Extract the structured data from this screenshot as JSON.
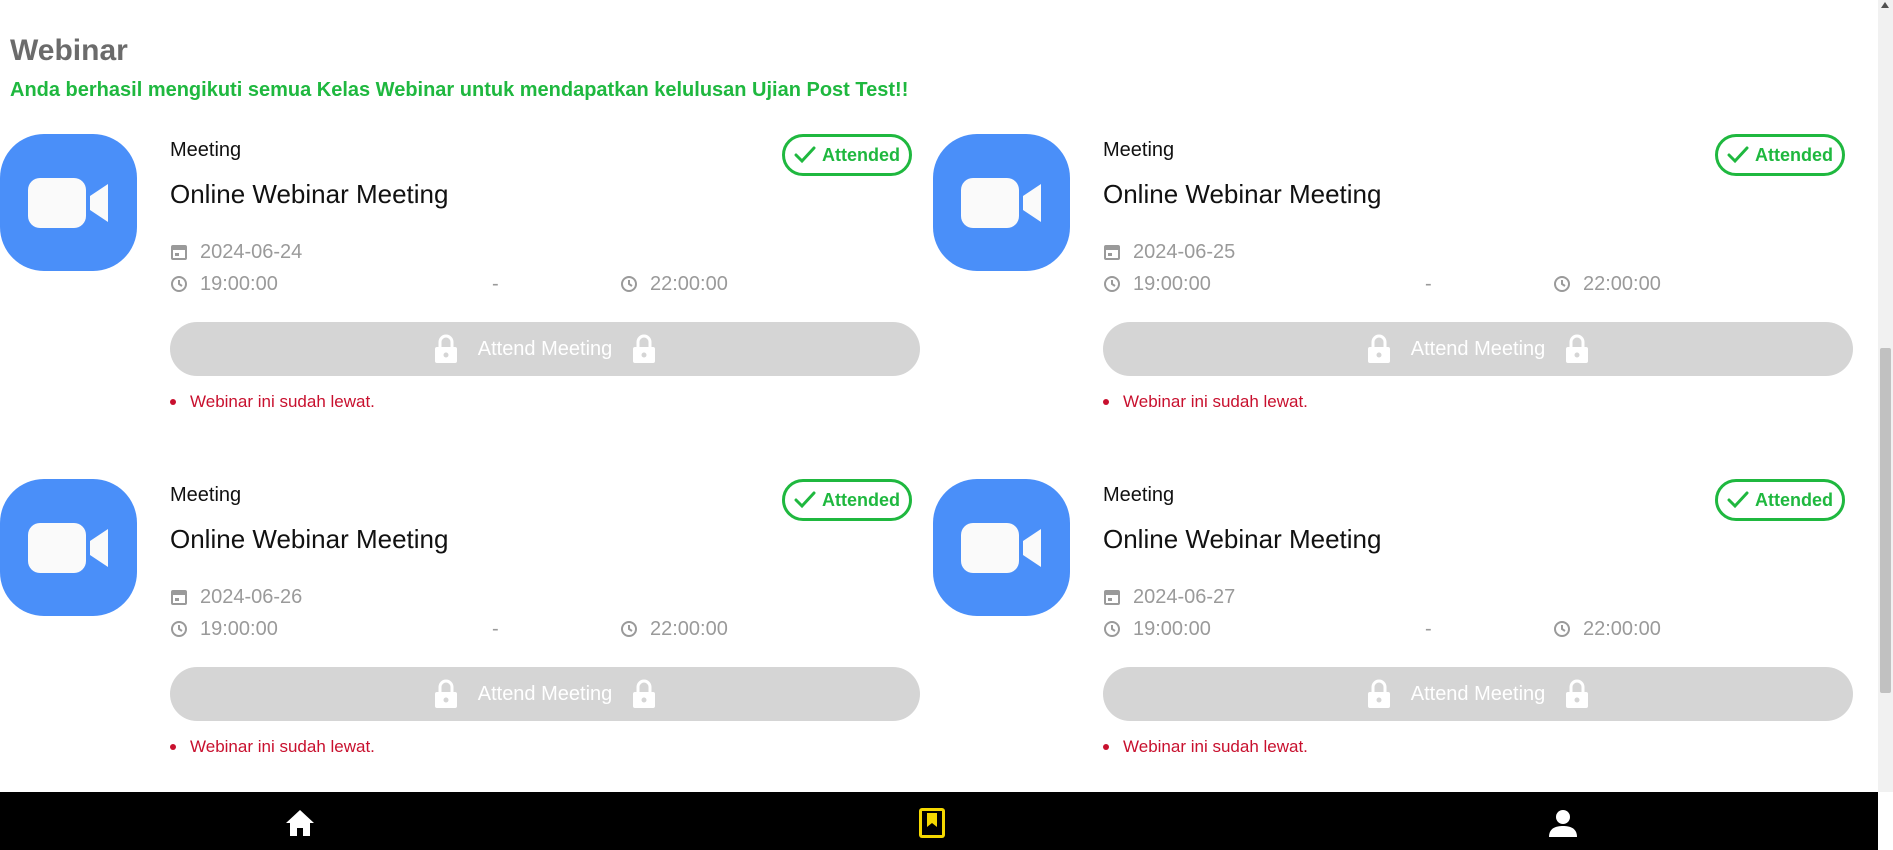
{
  "page": {
    "title": "Webinar",
    "subtitle": "Anda berhasil mengikuti semua Kelas Webinar untuk mendapatkan kelulusan Ujian Post Test!!"
  },
  "webinars": [
    {
      "kind": "Meeting",
      "name": "Online Webinar Meeting",
      "status": "Attended",
      "date": "2024-06-24",
      "time_start": "19:00:00",
      "time_separator": "-",
      "time_end": "22:00:00",
      "button_label": "Attend Meeting",
      "button_locked": true,
      "warning": "Webinar ini sudah lewat."
    },
    {
      "kind": "Meeting",
      "name": "Online Webinar Meeting",
      "status": "Attended",
      "date": "2024-06-25",
      "time_start": "19:00:00",
      "time_separator": "-",
      "time_end": "22:00:00",
      "button_label": "Attend Meeting",
      "button_locked": true,
      "warning": "Webinar ini sudah lewat."
    },
    {
      "kind": "Meeting",
      "name": "Online Webinar Meeting",
      "status": "Attended",
      "date": "2024-06-26",
      "time_start": "19:00:00",
      "time_separator": "-",
      "time_end": "22:00:00",
      "button_label": "Attend Meeting",
      "button_locked": true,
      "warning": "Webinar ini sudah lewat."
    },
    {
      "kind": "Meeting",
      "name": "Online Webinar Meeting",
      "status": "Attended",
      "date": "2024-06-27",
      "time_start": "19:00:00",
      "time_separator": "-",
      "time_end": "22:00:00",
      "button_label": "Attend Meeting",
      "button_locked": true,
      "warning": "Webinar ini sudah lewat."
    }
  ],
  "bottom_nav": {
    "items": [
      {
        "icon": "home-icon",
        "active": false
      },
      {
        "icon": "bookmark-icon",
        "active": true
      },
      {
        "icon": "person-icon",
        "active": false
      }
    ]
  },
  "colors": {
    "accent_green": "#1fb83f",
    "zoom_blue": "#4a8ff9",
    "warning_red": "#c8102e",
    "active_nav": "#f5d800",
    "disabled_button": "#d5d5d5"
  }
}
